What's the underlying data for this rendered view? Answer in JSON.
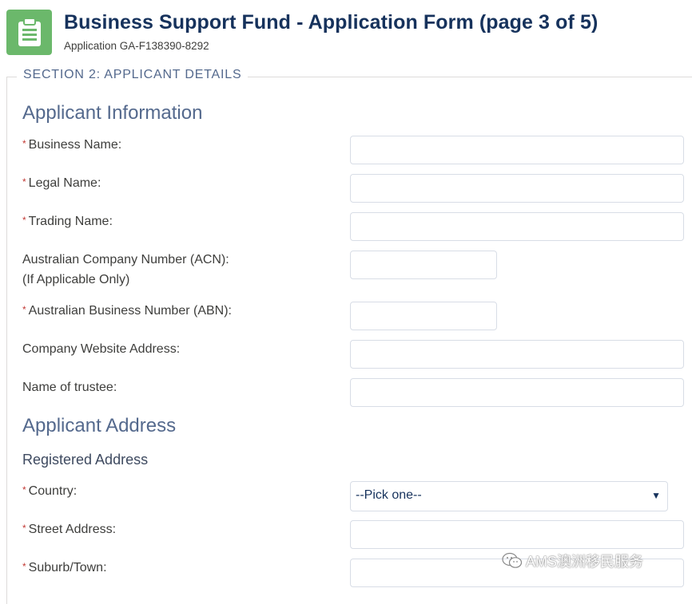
{
  "header": {
    "title": "Business Support Fund - Application Form (page 3 of 5)",
    "subtitle": "Application GA-F138390-8292",
    "icon": "clipboard-icon",
    "icon_color": "#6bb86b"
  },
  "section": {
    "legend": "SECTION 2: APPLICANT DETAILS",
    "applicant_info_heading": "Applicant Information",
    "applicant_address_heading": "Applicant Address",
    "registered_address_heading": "Registered Address"
  },
  "fields": {
    "business_name": {
      "label": "Business Name:",
      "required": "*",
      "value": ""
    },
    "legal_name": {
      "label": "Legal Name:",
      "required": "*",
      "value": ""
    },
    "trading_name": {
      "label": "Trading Name:",
      "required": "*",
      "value": ""
    },
    "acn": {
      "label": "Australian Company Number (ACN):",
      "label2": "(If Applicable Only)",
      "value": ""
    },
    "abn": {
      "label": "Australian Business Number (ABN):",
      "required": "*",
      "value": ""
    },
    "website": {
      "label": "Company Website Address:",
      "value": ""
    },
    "trustee": {
      "label": "Name of trustee:",
      "value": ""
    },
    "country": {
      "label": "Country:",
      "required": "*",
      "selected": "--Pick one--"
    },
    "street": {
      "label": "Street Address:",
      "required": "*",
      "value": ""
    },
    "suburb": {
      "label": "Suburb/Town:",
      "required": "*",
      "value": ""
    }
  },
  "watermark": {
    "text": "AMS澳洲移民服务"
  },
  "colors": {
    "required": "#c23934",
    "title": "#16325c",
    "heading": "#54698d"
  }
}
